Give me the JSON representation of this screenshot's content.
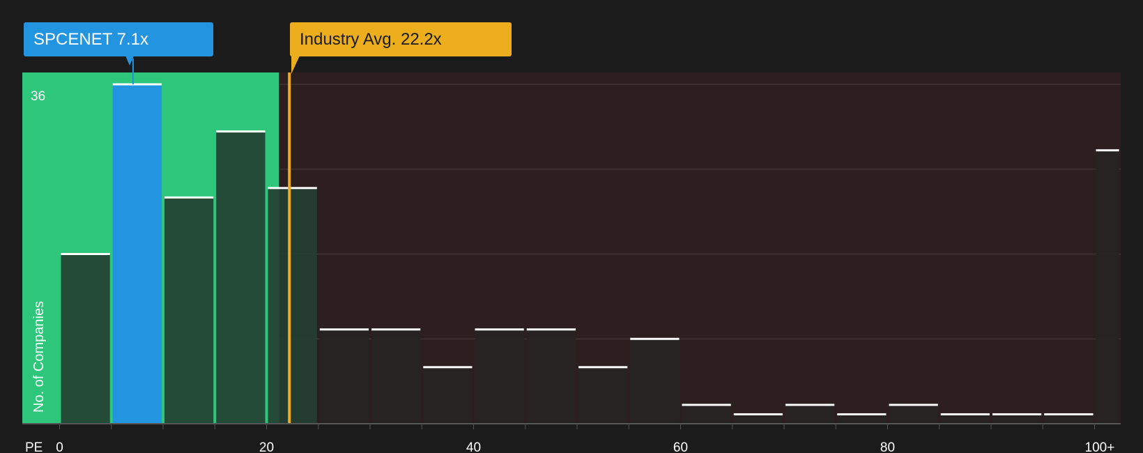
{
  "callouts": {
    "company": "SPCENET 7.1x",
    "industry": "Industry Avg. 22.2x"
  },
  "colors": {
    "background": "#1b1b1b",
    "undervalued_zone": "#2ec67a",
    "overvalued_zone": "#2d1f1f",
    "company_bar": "#2394e0",
    "industry_line": "#ecae1c",
    "bar": "#243f32",
    "bar_dark": "#272424",
    "bar_cap": "#ffffff"
  },
  "chart_data": {
    "type": "bar",
    "title": "",
    "xlabel": "PE",
    "ylabel": "No. of Companies",
    "y_tick_label": "36",
    "ylim": [
      0,
      36
    ],
    "xlim": [
      -3.5,
      102.5
    ],
    "x_ticks": [
      {
        "value": 0,
        "label": "0"
      },
      {
        "value": 20,
        "label": "20"
      },
      {
        "value": 40,
        "label": "40"
      },
      {
        "value": 60,
        "label": "60"
      },
      {
        "value": 80,
        "label": "80"
      },
      {
        "value": 100,
        "label": "100+"
      }
    ],
    "bins": [
      {
        "start": 0,
        "end": 5,
        "count": 18
      },
      {
        "start": 5,
        "end": 10,
        "count": 36
      },
      {
        "start": 10,
        "end": 15,
        "count": 24
      },
      {
        "start": 15,
        "end": 20,
        "count": 31
      },
      {
        "start": 20,
        "end": 25,
        "count": 25
      },
      {
        "start": 25,
        "end": 30,
        "count": 10
      },
      {
        "start": 30,
        "end": 35,
        "count": 10
      },
      {
        "start": 35,
        "end": 40,
        "count": 6
      },
      {
        "start": 40,
        "end": 45,
        "count": 10
      },
      {
        "start": 45,
        "end": 50,
        "count": 10
      },
      {
        "start": 50,
        "end": 55,
        "count": 6
      },
      {
        "start": 55,
        "end": 60,
        "count": 9
      },
      {
        "start": 60,
        "end": 65,
        "count": 2
      },
      {
        "start": 65,
        "end": 70,
        "count": 1
      },
      {
        "start": 70,
        "end": 75,
        "count": 2
      },
      {
        "start": 75,
        "end": 80,
        "count": 1
      },
      {
        "start": 80,
        "end": 85,
        "count": 2
      },
      {
        "start": 85,
        "end": 90,
        "count": 1
      },
      {
        "start": 90,
        "end": 95,
        "count": 1
      },
      {
        "start": 95,
        "end": 100,
        "count": 1
      },
      {
        "start": 100,
        "end": 102.5,
        "count": 29
      }
    ],
    "company_value": 7.1,
    "industry_average": 22.2,
    "undervalued_until": 21.2
  }
}
